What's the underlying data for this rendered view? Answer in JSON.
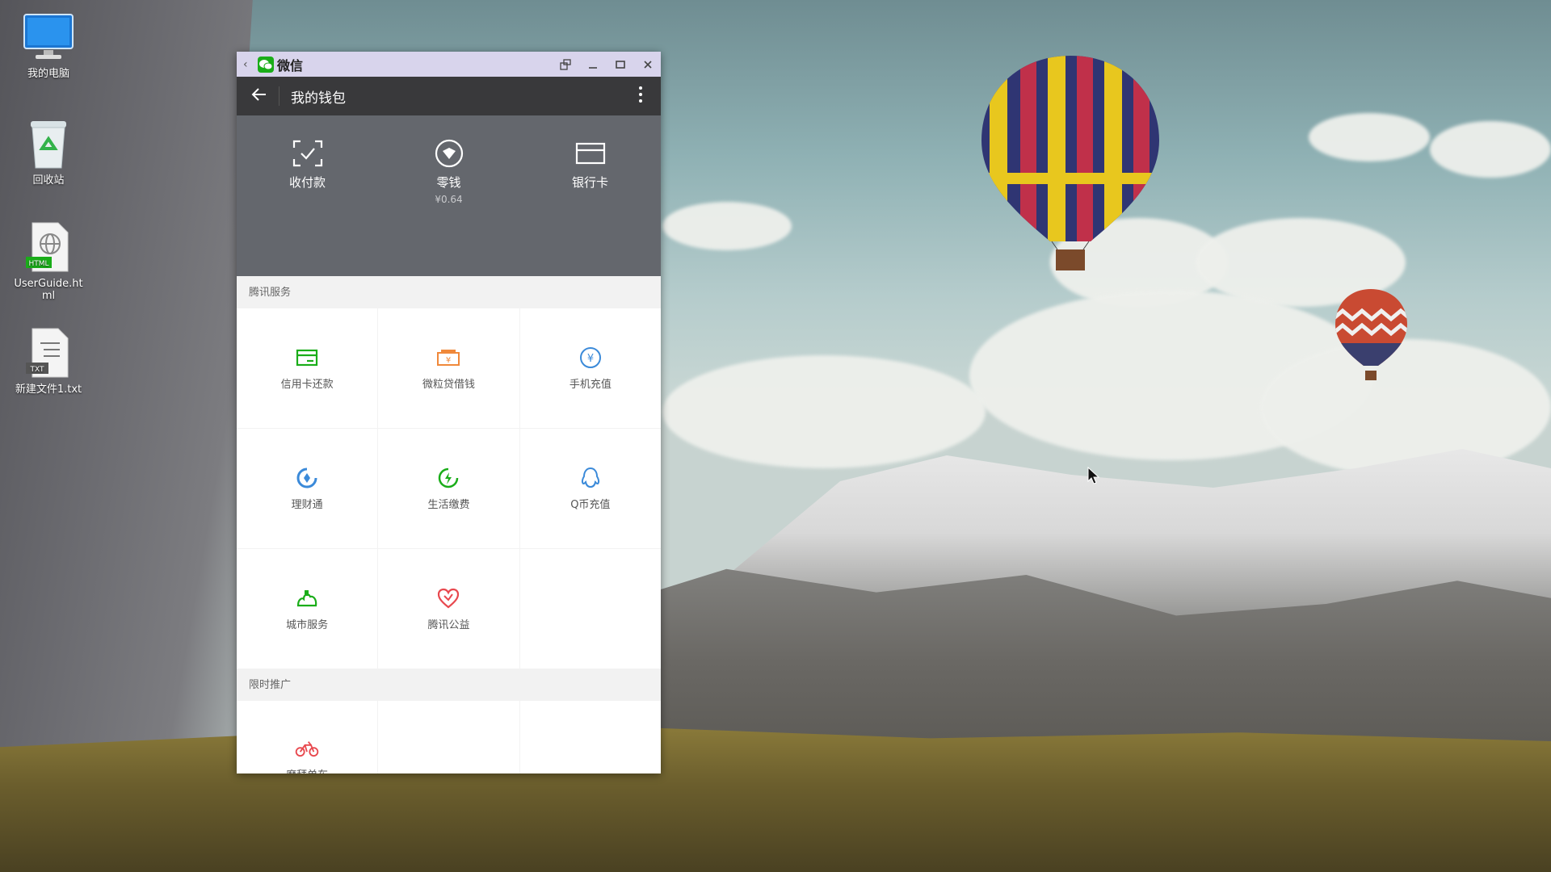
{
  "desktop": {
    "icons": [
      {
        "label": "我的电脑",
        "icon": "computer-icon"
      },
      {
        "label": "回收站",
        "icon": "recycle-bin-icon"
      },
      {
        "label": "UserGuide.html",
        "icon": "html-file-icon",
        "badge": "HTML"
      },
      {
        "label": "新建文件1.txt",
        "icon": "txt-file-icon",
        "badge": "TXT"
      }
    ]
  },
  "window": {
    "app_title": "微信",
    "controls": [
      "screen-rotate-icon",
      "minimize-icon",
      "maximize-icon",
      "close-icon"
    ]
  },
  "appbar": {
    "title": "我的钱包"
  },
  "hero": {
    "items": [
      {
        "label": "收付款",
        "icon": "scan-pay-icon"
      },
      {
        "label": "零钱",
        "sub": "¥0.64",
        "icon": "change-icon"
      },
      {
        "label": "银行卡",
        "icon": "bank-card-icon"
      }
    ]
  },
  "tencent_services": {
    "header": "腾讯服务",
    "items": [
      {
        "label": "信用卡还款",
        "icon": "credit-card-icon",
        "color": "#1aad19"
      },
      {
        "label": "微粒贷借钱",
        "icon": "loan-icon",
        "color": "#f0883a"
      },
      {
        "label": "手机充值",
        "icon": "yuan-icon",
        "color": "#3b8ad9"
      },
      {
        "label": "理财通",
        "icon": "wealth-icon",
        "color": "#3b8ad9"
      },
      {
        "label": "生活缴费",
        "icon": "lightning-icon",
        "color": "#1aad19"
      },
      {
        "label": "Q币充值",
        "icon": "qq-penguin-icon",
        "color": "#3b8ad9"
      },
      {
        "label": "城市服务",
        "icon": "city-icon",
        "color": "#1aad19"
      },
      {
        "label": "腾讯公益",
        "icon": "charity-heart-icon",
        "color": "#e8484e"
      }
    ]
  },
  "promotion": {
    "header": "限时推广",
    "items": [
      {
        "label": "摩拜单车",
        "icon": "bike-icon",
        "color": "#e8484e"
      }
    ]
  }
}
